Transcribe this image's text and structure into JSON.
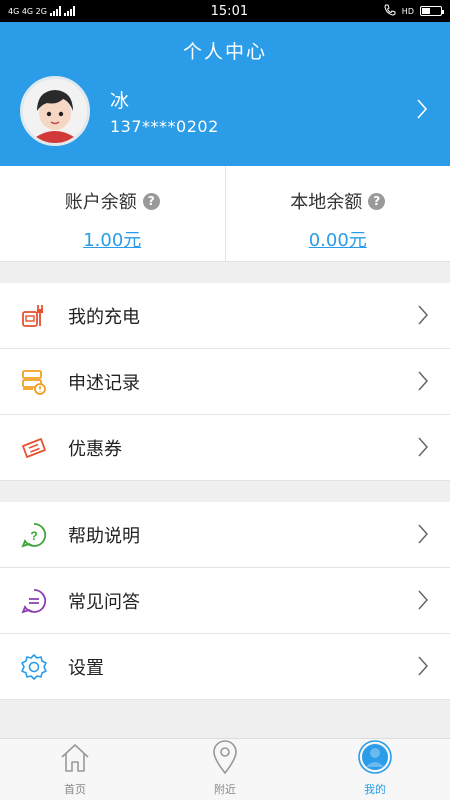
{
  "status_bar": {
    "network_left": "4G 4G 2G",
    "time": "15:01",
    "network_right": "HD"
  },
  "header": {
    "title": "个人中心"
  },
  "profile": {
    "name": "冰",
    "phone": "137****0202"
  },
  "balances": {
    "account": {
      "label": "账户余额",
      "value": "1.00元"
    },
    "local": {
      "label": "本地余额",
      "value": "0.00元"
    },
    "help_glyph": "?"
  },
  "menu_group_1": [
    {
      "label": "我的充电",
      "icon": "charging-icon",
      "color": "#e8512f"
    },
    {
      "label": "申述记录",
      "icon": "record-icon",
      "color": "#f0a020"
    },
    {
      "label": "优惠券",
      "icon": "coupon-icon",
      "color": "#e8512f"
    }
  ],
  "menu_group_2": [
    {
      "label": "帮助说明",
      "icon": "help-icon",
      "color": "#3aa33a"
    },
    {
      "label": "常见问答",
      "icon": "faq-icon",
      "color": "#8a3fb0"
    },
    {
      "label": "设置",
      "icon": "settings-icon",
      "color": "#2b9de8"
    }
  ],
  "tabbar": {
    "tabs": [
      {
        "label": "首页",
        "icon": "home-icon",
        "active": false
      },
      {
        "label": "附近",
        "icon": "location-pin-icon",
        "active": false
      },
      {
        "label": "我的",
        "icon": "user-icon",
        "active": true
      }
    ]
  },
  "colors": {
    "primary": "#2b9de8",
    "background": "#efefef"
  }
}
